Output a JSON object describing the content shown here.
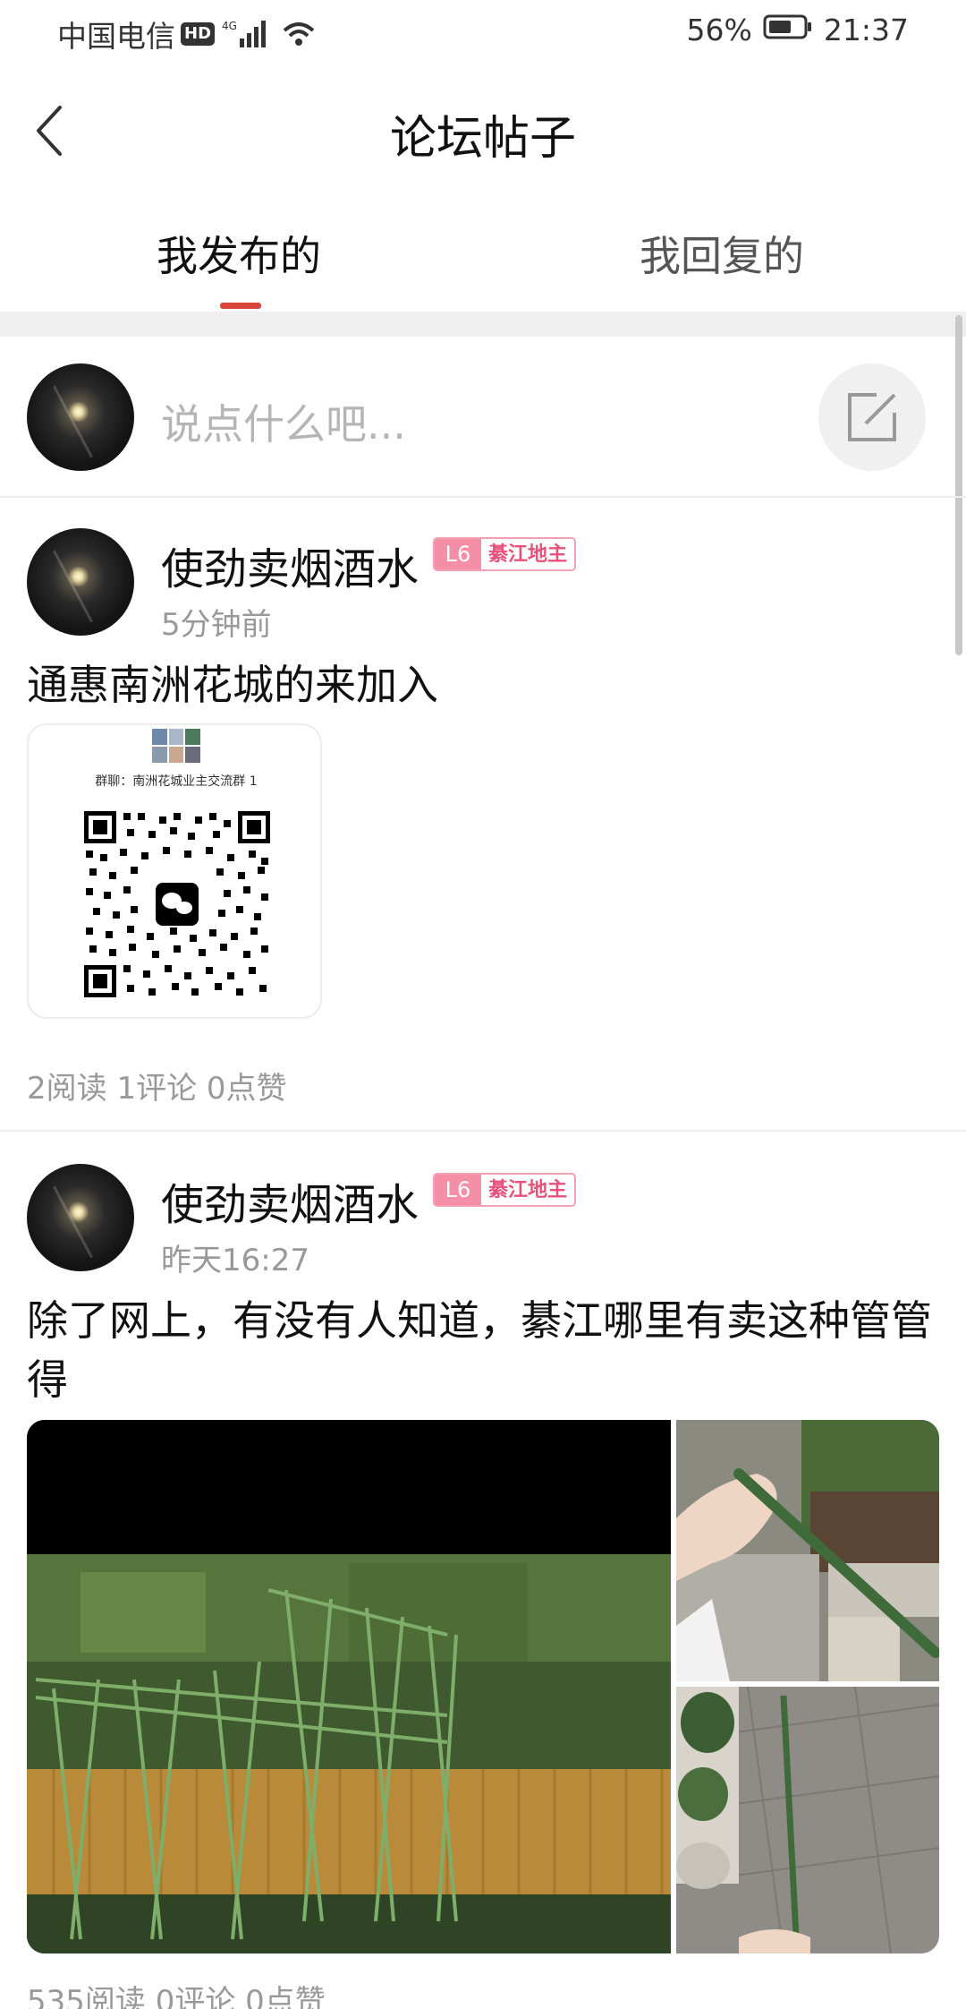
{
  "status_bar": {
    "carrier": "中国电信",
    "hd": "HD",
    "network": "4G",
    "battery": "56%",
    "time": "21:37"
  },
  "header": {
    "title": "论坛帖子",
    "back_icon": "chevron-left-icon"
  },
  "tabs": [
    {
      "label": "我发布的",
      "active": true
    },
    {
      "label": "我回复的",
      "active": false
    }
  ],
  "composer": {
    "placeholder": "说点什么吧...",
    "icon": "edit-icon"
  },
  "posts": [
    {
      "username": "使劲卖烟酒水",
      "level": "L6",
      "level_title": "綦江地主",
      "time": "5分钟前",
      "content": "通惠南洲花城的来加入",
      "qr_group_name": "群聊：南洲花城业主交流群 1",
      "stats": "2阅读 1评论 0点赞"
    },
    {
      "username": "使劲卖烟酒水",
      "level": "L6",
      "level_title": "綦江地主",
      "time": "昨天16:27",
      "content": "除了网上，有没有人知道，綦江哪里有卖这种管管得",
      "stats": "535阅读 0评论 0点赞"
    }
  ],
  "colors": {
    "accent": "#d9453d",
    "badge_pink": "#f58fa8",
    "muted_text": "#999999"
  }
}
